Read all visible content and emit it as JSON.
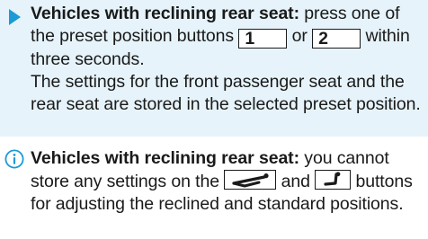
{
  "step": {
    "lead": "Vehicles with reclining rear seat:",
    "text_a": " press one of the preset position buttons ",
    "key_1": "1",
    "or": " or ",
    "key_2": "2",
    "text_b": " within three seconds.",
    "paragraph_2": "The settings for the front passenger seat and the rear seat are stored in the selected preset position."
  },
  "note": {
    "icon": "info-icon",
    "lead": "Vehicles with reclining rear seat:",
    "text_a": " you cannot store any settings on the ",
    "icon_recline": "recline-seat-icon",
    "and": " and ",
    "icon_upright": "upright-seat-icon",
    "text_b": " buttons for adjusting the reclined and standard positions."
  },
  "colors": {
    "band": "#e6f3fa",
    "accent": "#1c9ad6",
    "text": "#1a1a1a"
  }
}
